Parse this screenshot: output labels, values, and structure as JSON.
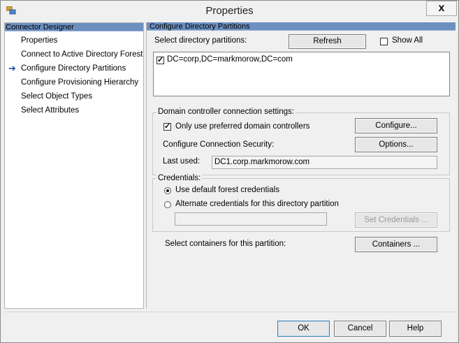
{
  "window": {
    "title": "Properties",
    "close_label": "x"
  },
  "nav": {
    "header": "Connector Designer",
    "items": [
      {
        "label": "Properties",
        "selected": false
      },
      {
        "label": "Connect to Active Directory Forest",
        "selected": false
      },
      {
        "label": "Configure Directory Partitions",
        "selected": true
      },
      {
        "label": "Configure Provisioning Hierarchy",
        "selected": false
      },
      {
        "label": "Select Object Types",
        "selected": false
      },
      {
        "label": "Select Attributes",
        "selected": false
      }
    ],
    "current_arrow": "➔"
  },
  "content": {
    "header": "Configure Directory Partitions",
    "select_partitions_label": "Select directory partitions:",
    "refresh_label": "Refresh",
    "show_all_label": "Show All",
    "show_all_checked": false,
    "partitions": [
      {
        "label": "DC=corp,DC=markmorow,DC=com",
        "checked": true
      }
    ],
    "dc_group": {
      "title": "Domain controller connection settings:",
      "preferred_label": "Only use preferred domain controllers",
      "preferred_checked": true,
      "configure_label": "Configure...",
      "security_label": "Configure Connection Security:",
      "options_label": "Options...",
      "last_used_label": "Last used:",
      "last_used_value": "DC1.corp.markmorow.com"
    },
    "credentials_group": {
      "title": "Credentials:",
      "default_label": "Use default forest credentials",
      "alternate_label": "Alternate credentials for this directory partition",
      "selected": "default",
      "credentials_value": "",
      "set_credentials_label": "Set Credentials ..."
    },
    "containers_label": "Select containers for this partition:",
    "containers_button": "Containers ..."
  },
  "footer": {
    "ok_label": "OK",
    "cancel_label": "Cancel",
    "help_label": "Help"
  },
  "colors": {
    "pane_header": "#6c8fc0",
    "nav_arrow": "#1f4aa8"
  }
}
